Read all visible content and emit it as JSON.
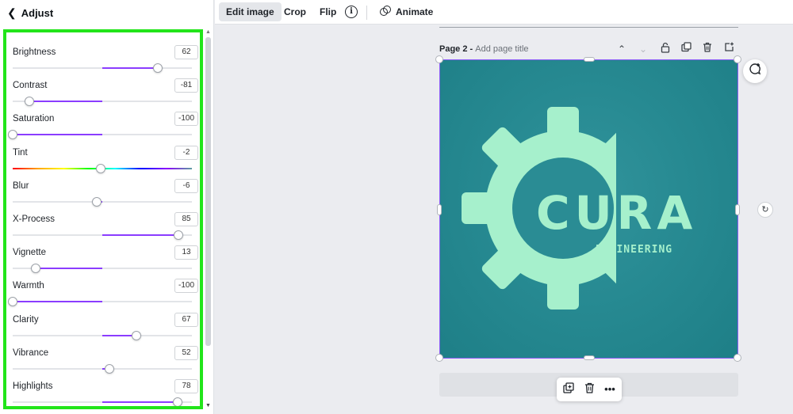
{
  "panel": {
    "back_label": "Adjust",
    "adjustments": [
      {
        "label": "Brightness",
        "value": "62",
        "level": 0.81
      },
      {
        "label": "Contrast",
        "value": "-81",
        "level": 0.095
      },
      {
        "label": "Saturation",
        "value": "-100",
        "level": 0.0
      },
      {
        "label": "Tint",
        "value": "-2",
        "level": 0.49,
        "rainbow": true
      },
      {
        "label": "Blur",
        "value": "-6",
        "level": 0.47
      },
      {
        "label": "X-Process",
        "value": "85",
        "level": 0.925
      },
      {
        "label": "Vignette",
        "value": "13",
        "level": 0.13
      },
      {
        "label": "Warmth",
        "value": "-100",
        "level": 0.0
      },
      {
        "label": "Clarity",
        "value": "67",
        "level": 0.69
      },
      {
        "label": "Vibrance",
        "value": "52",
        "level": 0.54
      },
      {
        "label": "Highlights",
        "value": "78",
        "level": 0.92
      }
    ]
  },
  "toolbar": {
    "edit_image": "Edit image",
    "crop": "Crop",
    "flip": "Flip",
    "info": "i",
    "animate": "Animate"
  },
  "page": {
    "number_label": "Page 2 - ",
    "title_placeholder": "Add page title"
  },
  "logo": {
    "word": "CURA",
    "sub": "ENGINEERING"
  },
  "colors": {
    "accent": "#8b3dff",
    "highlight_border": "#22e51a",
    "artboard_bg": "#278a92",
    "logo_mint": "#a6f0cc"
  }
}
